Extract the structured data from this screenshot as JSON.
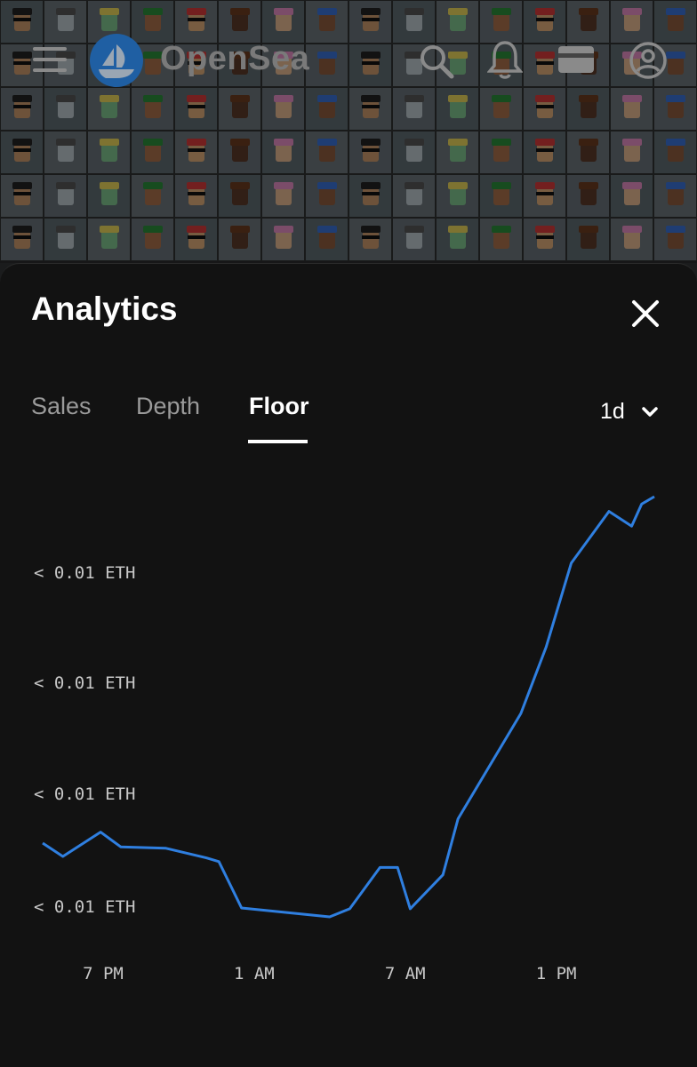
{
  "header": {
    "brand": "OpenSea",
    "icons": [
      "menu-icon",
      "opensea-logo-icon",
      "search-icon",
      "bell-icon",
      "wallet-icon",
      "account-icon"
    ]
  },
  "sheet": {
    "title": "Analytics",
    "tabs": [
      {
        "label": "Sales",
        "active": false
      },
      {
        "label": "Depth",
        "active": false
      },
      {
        "label": "Floor",
        "active": true
      }
    ],
    "range": "1d"
  },
  "colors": {
    "line": "#2f7fe0",
    "sheet_bg": "#121212"
  },
  "chart_data": {
    "type": "line",
    "title": "",
    "xlabel": "",
    "ylabel": "",
    "x_ticks": [
      "7 PM",
      "1 AM",
      "7 AM",
      "1 PM"
    ],
    "y_ticks": [
      "< 0.01 ETH",
      "< 0.01 ETH",
      "< 0.01 ETH",
      "< 0.01 ETH"
    ],
    "x_range_hours": [
      16.5,
      15.9
    ],
    "series": [
      {
        "name": "",
        "x": [
          16.6,
          17.4,
          18.9,
          19.7,
          21.5,
          23.1,
          23.6,
          24.5,
          28.0,
          28.8,
          30.0,
          30.7,
          31.2,
          32.5,
          33.1,
          35.6,
          36.6,
          37.6,
          39.1,
          40.0,
          40.4,
          40.9
        ],
        "y": [
          0.0049,
          0.00472,
          0.00505,
          0.00485,
          0.00483,
          0.0047,
          0.00465,
          0.00402,
          0.0039,
          0.00401,
          0.00457,
          0.00457,
          0.00401,
          0.00447,
          0.00523,
          0.00666,
          0.00756,
          0.0087,
          0.0094,
          0.0092,
          0.0095,
          0.0096
        ]
      }
    ]
  }
}
